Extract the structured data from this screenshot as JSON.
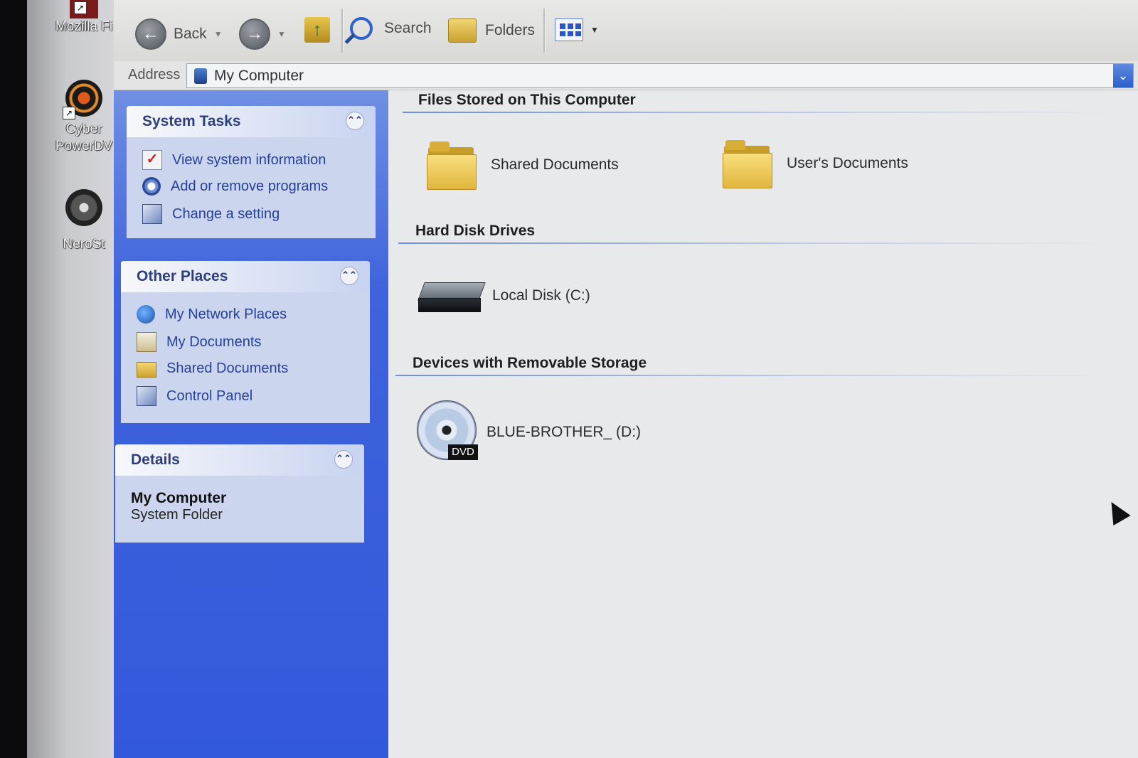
{
  "desktop": {
    "icons": [
      {
        "label": "Mozilla Fi",
        "icon": "firefox-icon"
      },
      {
        "label": "Cyber PowerDV",
        "icon": "powerdvd-icon"
      },
      {
        "label": "NeroSt",
        "icon": "nero-icon"
      }
    ]
  },
  "toolbar": {
    "back_label": "Back",
    "search_label": "Search",
    "folders_label": "Folders"
  },
  "address": {
    "label": "Address",
    "value": "My Computer"
  },
  "taskpane": {
    "system_tasks": {
      "title": "System Tasks",
      "items": [
        {
          "label": "View system information",
          "icon": "system-info-icon"
        },
        {
          "label": "Add or remove programs",
          "icon": "add-remove-icon"
        },
        {
          "label": "Change a setting",
          "icon": "control-panel-icon"
        }
      ]
    },
    "other_places": {
      "title": "Other Places",
      "items": [
        {
          "label": "My Network Places",
          "icon": "network-icon"
        },
        {
          "label": "My Documents",
          "icon": "documents-icon"
        },
        {
          "label": "Shared Documents",
          "icon": "folder-icon"
        },
        {
          "label": "Control Panel",
          "icon": "control-panel-icon"
        }
      ]
    },
    "details": {
      "title": "Details",
      "name": "My Computer",
      "type": "System Folder"
    }
  },
  "content": {
    "groups": [
      {
        "title": "Files Stored on This Computer",
        "items": [
          {
            "label": "Shared Documents",
            "icon": "folder-icon"
          },
          {
            "label": "User's Documents",
            "icon": "folder-icon"
          }
        ]
      },
      {
        "title": "Hard Disk Drives",
        "items": [
          {
            "label": "Local Disk (C:)",
            "icon": "hard-disk-icon"
          }
        ]
      },
      {
        "title": "Devices with Removable Storage",
        "items": [
          {
            "label": "BLUE-BROTHER_ (D:)",
            "icon": "dvd-drive-icon",
            "badge": "DVD"
          }
        ]
      }
    ]
  }
}
